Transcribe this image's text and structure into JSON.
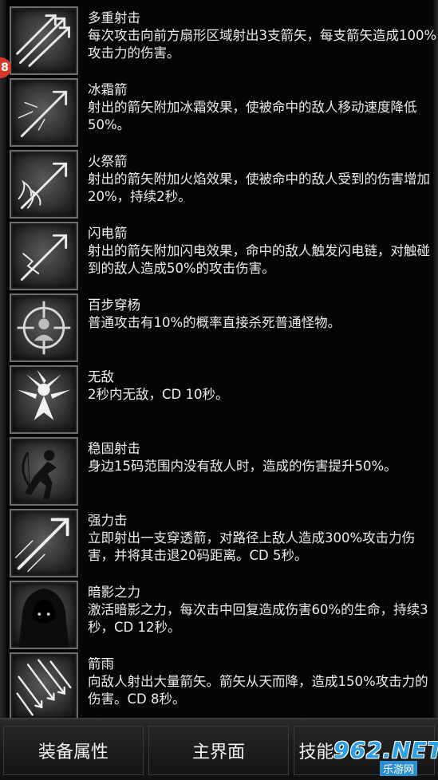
{
  "badge": "8",
  "skills": [
    {
      "name": "多重射击",
      "desc": "每次攻击向前方扇形区域射出3支箭矢，每支箭矢造成100%攻击力的伤害。",
      "icon": "multi-arrow-icon"
    },
    {
      "name": "冰霜箭",
      "desc": "射出的箭矢附加冰霜效果，使被命中的敌人移动速度降低50%。",
      "icon": "frost-arrow-icon"
    },
    {
      "name": "火祭箭",
      "desc": "射出的箭矢附加火焰效果，使被命中的敌人受到的伤害增加20%，持续2秒。",
      "icon": "fire-arrow-icon"
    },
    {
      "name": "闪电箭",
      "desc": "射出的箭矢附加闪电效果，命中的敌人触发闪电链，对触碰到的敌人造成50%的攻击伤害。",
      "icon": "lightning-arrow-icon"
    },
    {
      "name": "百步穿杨",
      "desc": "普通攻击有10%的概率直接杀死普通怪物。",
      "icon": "crosshair-icon"
    },
    {
      "name": "无敌",
      "desc": "2秒内无敌，CD 10秒。",
      "icon": "invincible-icon"
    },
    {
      "name": "稳固射击",
      "desc": "身边15码范围内没有敌人时，造成的伤害提升50%。",
      "icon": "archer-icon"
    },
    {
      "name": "强力击",
      "desc": "立即射出一支穿透箭，对路径上敌人造成300%攻击力伤害，并将其击退20码距离。CD 5秒。",
      "icon": "power-arrow-icon"
    },
    {
      "name": "暗影之力",
      "desc": "激活暗影之力，每次击中回复造成伤害60%的生命，持续3秒，CD 12秒。",
      "icon": "shadow-hood-icon"
    },
    {
      "name": "箭雨",
      "desc": "向敌人射出大量箭矢。箭矢从天而降，造成150%攻击力的伤害。CD 8秒。",
      "icon": "arrow-rain-icon"
    }
  ],
  "bottom_tabs": [
    "装备属性",
    "主界面",
    "技能"
  ],
  "watermark": {
    "main": "962.NET",
    "sub": "乐游网"
  }
}
